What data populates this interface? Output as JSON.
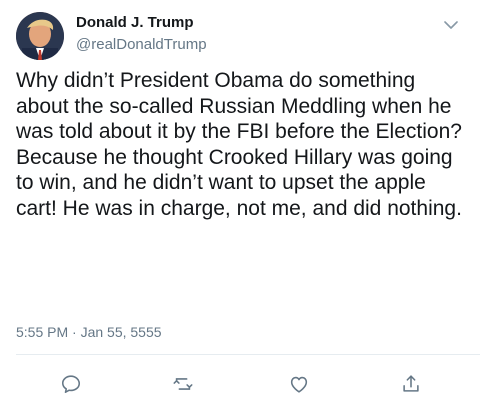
{
  "tweet": {
    "author_name": "Donald J. Trump",
    "author_handle": "@realDonaldTrump",
    "text": "Why didn’t President Obama do something about the so-called Russian Meddling when he was told about it by the FBI before the Election? Because he thought Crooked Hillary was going to win, and he didn’t want to upset the apple cart! He was in charge, not me, and did nothing.",
    "timestamp": "5:55 PM · Jan 55, 5555"
  },
  "icons": {
    "menu": "chevron-down-icon",
    "reply": "reply-icon",
    "retweet": "retweet-icon",
    "like": "heart-icon",
    "share": "share-icon"
  },
  "colors": {
    "primary_text": "#14171a",
    "secondary_text": "#657786",
    "icon": "#657786",
    "divider": "#e6ecf0"
  }
}
